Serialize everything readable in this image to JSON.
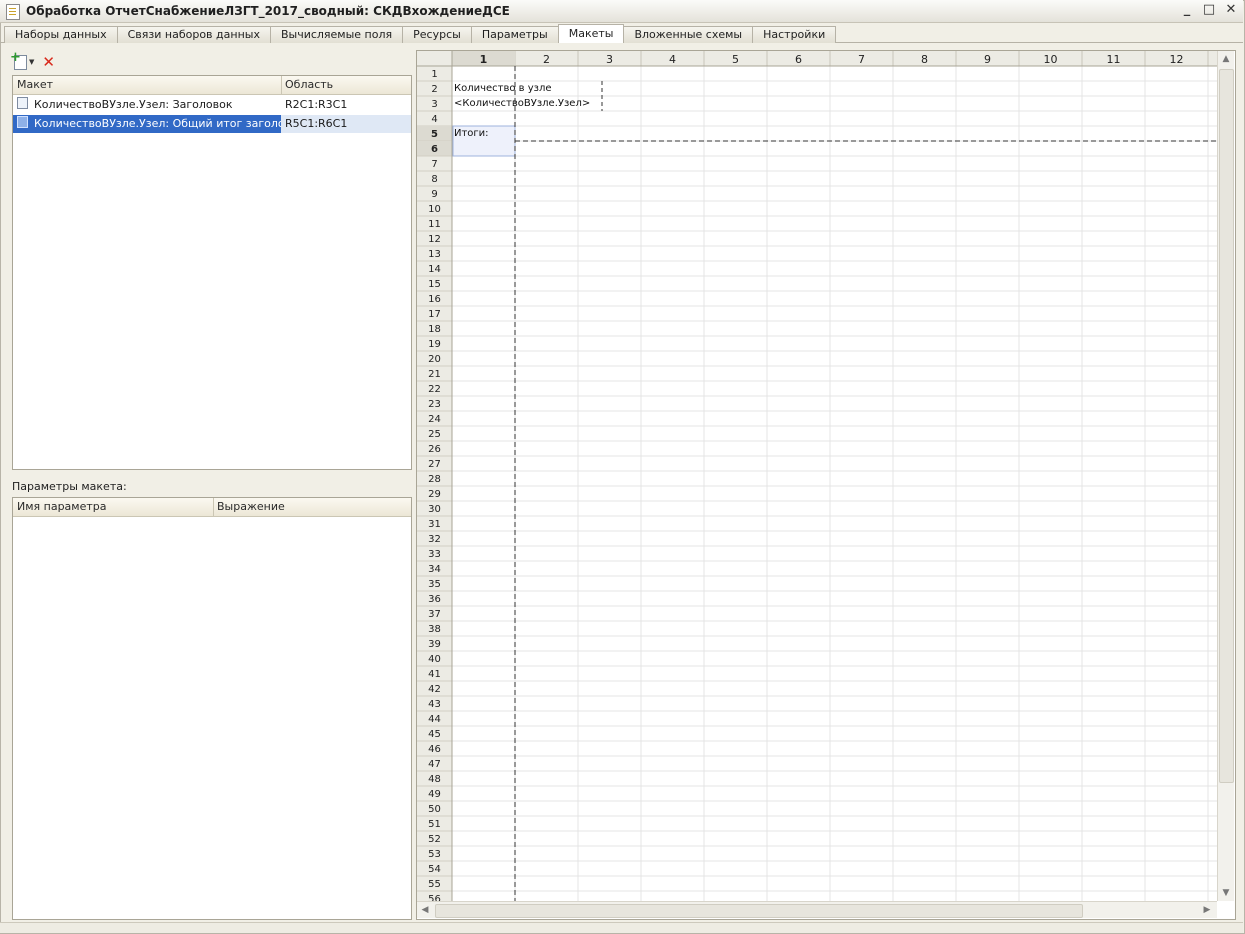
{
  "window": {
    "title": "Обработка ОтчетСнабжениеЛЗГТ_2017_сводный: СКДВхождениеДСЕ",
    "minimize": "_",
    "restore": "□",
    "close": "✕"
  },
  "tabs": [
    {
      "label": "Наборы данных",
      "active": false
    },
    {
      "label": "Связи наборов данных",
      "active": false
    },
    {
      "label": "Вычисляемые поля",
      "active": false
    },
    {
      "label": "Ресурсы",
      "active": false
    },
    {
      "label": "Параметры",
      "active": false
    },
    {
      "label": "Макеты",
      "active": true
    },
    {
      "label": "Вложенные схемы",
      "active": false
    },
    {
      "label": "Настройки",
      "active": false
    }
  ],
  "toolbar": {
    "add_icon": "add-icon",
    "delete_icon": "delete-icon"
  },
  "layouts_table": {
    "columns": [
      "Макет",
      "Область"
    ],
    "rows": [
      {
        "name": "КоличествоВУзле.Узел: Заголовок",
        "area": "R2C1:R3C1",
        "selected": false
      },
      {
        "name": "КоличествоВУзле.Узел: Общий итог заголо...",
        "area": "R5C1:R6C1",
        "selected": true
      }
    ]
  },
  "params": {
    "label": "Параметры макета:",
    "columns": [
      "Имя параметра",
      "Выражение"
    ]
  },
  "sheet": {
    "column_headers": [
      "1",
      "2",
      "3",
      "4",
      "5",
      "6",
      "7",
      "8",
      "9",
      "10",
      "11",
      "12"
    ],
    "row_count": 56,
    "active_column": "1",
    "highlighted_rows": [
      "5",
      "6"
    ],
    "cells": [
      {
        "row": "2",
        "col": "1",
        "text": "Количество в узле"
      },
      {
        "row": "3",
        "col": "1",
        "text": "<КоличествоВУзле.Узел>"
      },
      {
        "row": "5",
        "col": "1",
        "text": "Итоги:"
      }
    ]
  },
  "colors": {
    "selection": "#3169c6",
    "grid_line": "#e4e4e4",
    "header_bg": "#ecebe4"
  }
}
